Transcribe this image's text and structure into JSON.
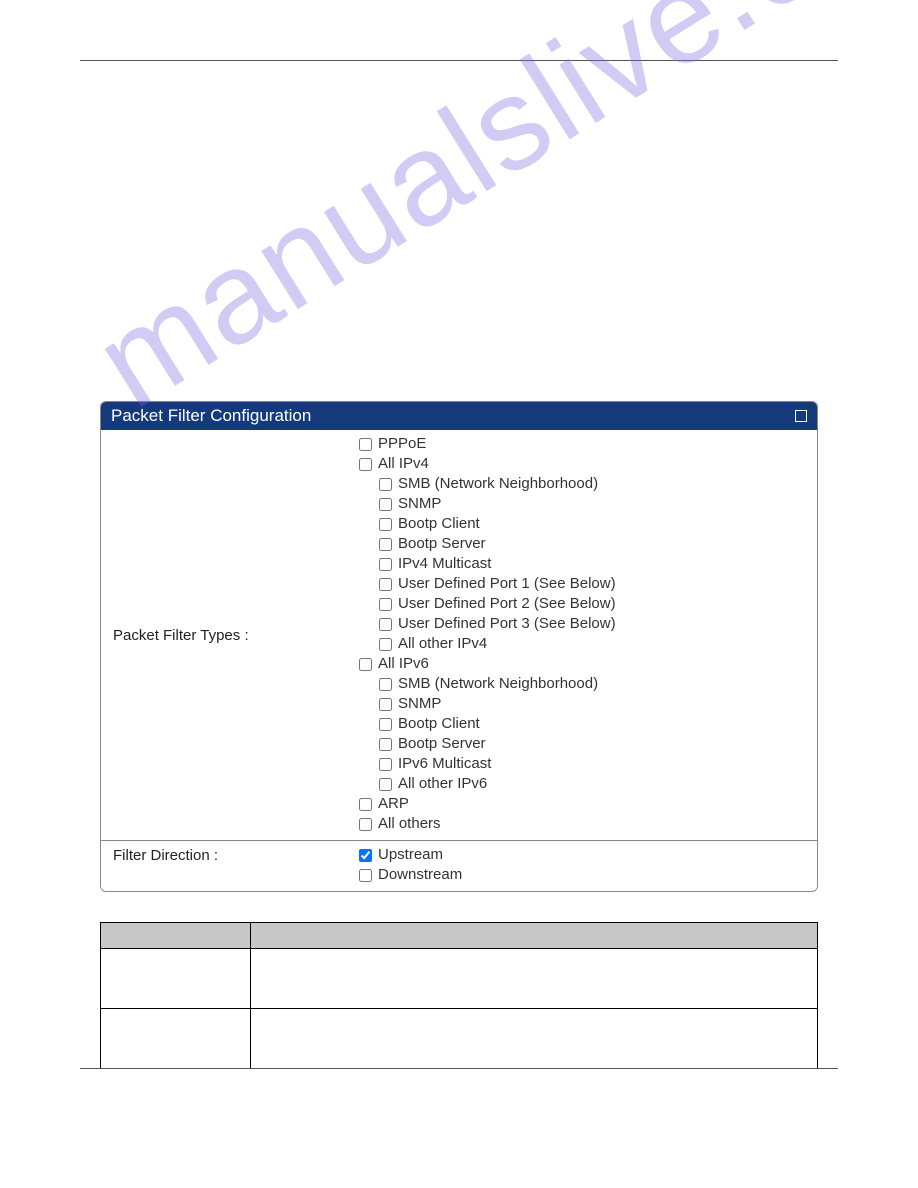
{
  "watermark_text": "manualslive.com",
  "panel": {
    "title": "Packet Filter Configuration",
    "rows": {
      "types": {
        "label": "Packet Filter Types :",
        "items": [
          {
            "id": "pppoe",
            "text": "PPPoE",
            "indent": 1,
            "checked": false
          },
          {
            "id": "all-ipv4",
            "text": "All IPv4",
            "indent": 1,
            "checked": false
          },
          {
            "id": "ipv4-smb",
            "text": "SMB (Network Neighborhood)",
            "indent": 2,
            "checked": false
          },
          {
            "id": "ipv4-snmp",
            "text": "SNMP",
            "indent": 2,
            "checked": false
          },
          {
            "id": "ipv4-bootp-client",
            "text": "Bootp Client",
            "indent": 2,
            "checked": false
          },
          {
            "id": "ipv4-bootp-server",
            "text": "Bootp Server",
            "indent": 2,
            "checked": false
          },
          {
            "id": "ipv4-multicast",
            "text": "IPv4 Multicast",
            "indent": 2,
            "checked": false
          },
          {
            "id": "ipv4-udp1",
            "text": "User Defined Port 1 (See Below)",
            "indent": 2,
            "checked": false
          },
          {
            "id": "ipv4-udp2",
            "text": "User Defined Port 2 (See Below)",
            "indent": 2,
            "checked": false
          },
          {
            "id": "ipv4-udp3",
            "text": "User Defined Port 3 (See Below)",
            "indent": 2,
            "checked": false
          },
          {
            "id": "ipv4-other",
            "text": "All other IPv4",
            "indent": 2,
            "checked": false
          },
          {
            "id": "all-ipv6",
            "text": "All IPv6",
            "indent": 1,
            "checked": false
          },
          {
            "id": "ipv6-smb",
            "text": "SMB (Network Neighborhood)",
            "indent": 2,
            "checked": false
          },
          {
            "id": "ipv6-snmp",
            "text": "SNMP",
            "indent": 2,
            "checked": false
          },
          {
            "id": "ipv6-bootp-client",
            "text": "Bootp Client",
            "indent": 2,
            "checked": false
          },
          {
            "id": "ipv6-bootp-server",
            "text": "Bootp Server",
            "indent": 2,
            "checked": false
          },
          {
            "id": "ipv6-multicast",
            "text": "IPv6 Multicast",
            "indent": 2,
            "checked": false
          },
          {
            "id": "ipv6-other",
            "text": "All other IPv6",
            "indent": 2,
            "checked": false
          },
          {
            "id": "arp",
            "text": "ARP",
            "indent": 1,
            "checked": false
          },
          {
            "id": "all-others",
            "text": "All others",
            "indent": 1,
            "checked": false
          }
        ]
      },
      "direction": {
        "label": "Filter Direction :",
        "items": [
          {
            "id": "upstream",
            "text": "Upstream",
            "indent": 1,
            "checked": true
          },
          {
            "id": "downstream",
            "text": "Downstream",
            "indent": 1,
            "checked": false
          }
        ]
      }
    }
  },
  "table": {
    "headHCol1": "",
    "headerCol2": "",
    "rows": [
      {
        "c1": "",
        "c2": ""
      },
      {
        "c1": "",
        "c2": ""
      }
    ]
  }
}
